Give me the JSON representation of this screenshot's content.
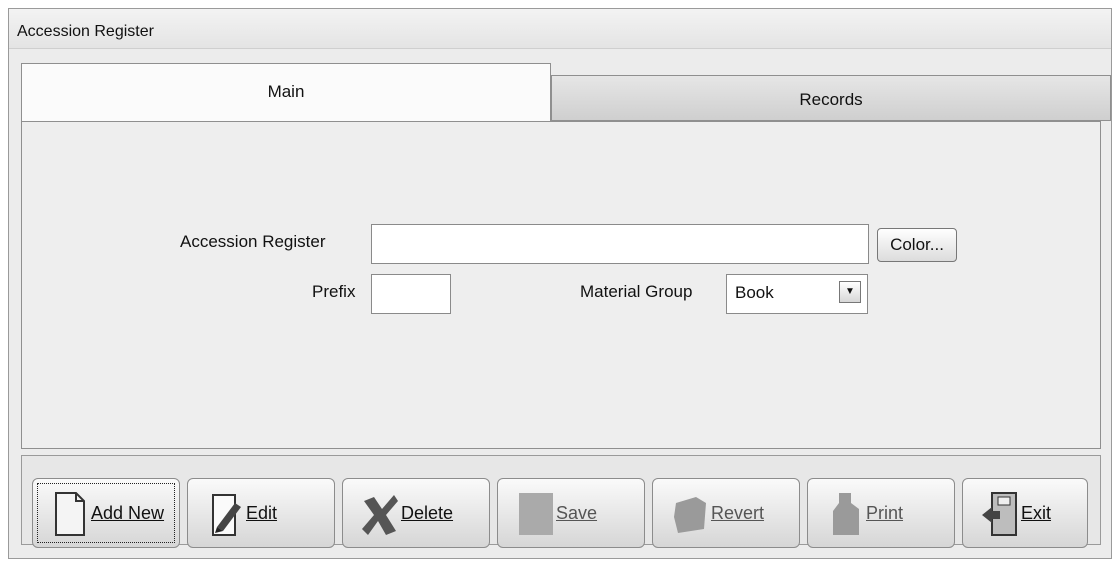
{
  "window": {
    "title": "Accession Register"
  },
  "tabs": [
    {
      "label": "Main",
      "active": true
    },
    {
      "label": "Records",
      "active": false
    }
  ],
  "form": {
    "accession_register_label": "Accession Register",
    "accession_register_value": "",
    "color_button_label": "Color...",
    "prefix_label": "Prefix",
    "prefix_value": "",
    "material_group_label": "Material Group",
    "material_group_value": "Book"
  },
  "toolbar": {
    "buttons": [
      {
        "label": "Add New",
        "icon": "add-new-document-icon",
        "mnemonic": "A",
        "enabled": true
      },
      {
        "label": "Edit",
        "icon": "edit-pen-icon",
        "mnemonic": "E",
        "enabled": true
      },
      {
        "label": "Delete",
        "icon": "delete-x-icon",
        "mnemonic": "D",
        "enabled": true
      },
      {
        "label": "Save",
        "icon": "save-icon",
        "mnemonic": "S",
        "enabled": false
      },
      {
        "label": "Revert",
        "icon": "revert-icon",
        "mnemonic": "R",
        "enabled": false
      },
      {
        "label": "Print",
        "icon": "print-icon",
        "mnemonic": "P",
        "enabled": false
      },
      {
        "label": "Exit",
        "icon": "exit-door-icon",
        "mnemonic": "x",
        "enabled": true
      }
    ]
  },
  "colors": {
    "window_bg": "#ececec",
    "panel_bg": "#eeeeee",
    "border": "#8f8f8f"
  }
}
